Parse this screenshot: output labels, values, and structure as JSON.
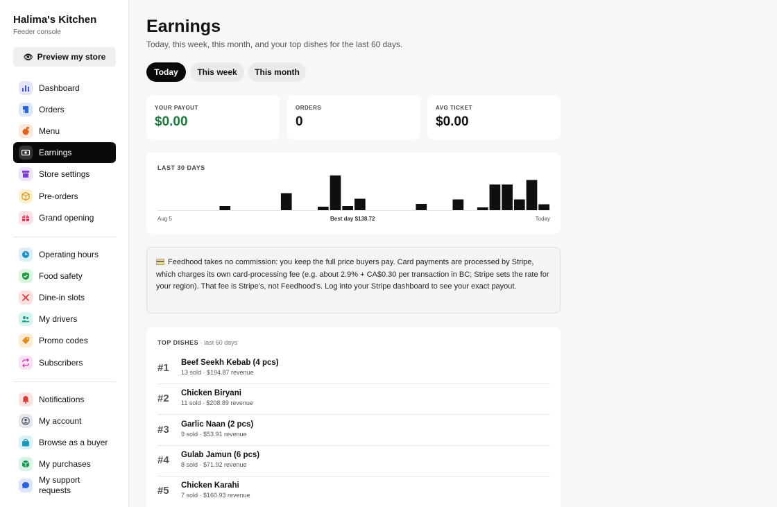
{
  "sidebar": {
    "brand": "Halima's Kitchen",
    "subtitle": "Feeder console",
    "preview_label": "Preview my store",
    "groups": [
      [
        {
          "label": "Dashboard",
          "icon": "bar-chart-icon",
          "color": "#e4e6fb",
          "fg": "#4a55d6"
        },
        {
          "label": "Orders",
          "icon": "receipt-icon",
          "color": "#dde7fb",
          "fg": "#2e62d9"
        },
        {
          "label": "Menu",
          "icon": "food-icon",
          "color": "#fde8d9",
          "fg": "#e2621b"
        },
        {
          "label": "Earnings",
          "icon": "money-icon",
          "color": "#333333",
          "fg": "#ffffff",
          "active": true
        },
        {
          "label": "Store settings",
          "icon": "store-icon",
          "color": "#ece3fb",
          "fg": "#7c3ad6"
        },
        {
          "label": "Pre-orders",
          "icon": "box-icon",
          "color": "#fdf0cf",
          "fg": "#d9941b"
        },
        {
          "label": "Grand opening",
          "icon": "gift-icon",
          "color": "#fde1e6",
          "fg": "#d93a57"
        }
      ],
      [
        {
          "label": "Operating hours",
          "icon": "clock-icon",
          "color": "#dbeff8",
          "fg": "#1f8fc6"
        },
        {
          "label": "Food safety",
          "icon": "shield-icon",
          "color": "#dcf4e2",
          "fg": "#1e9a48"
        },
        {
          "label": "Dine-in slots",
          "icon": "utensils-icon",
          "color": "#fde1e1",
          "fg": "#d93a3a"
        },
        {
          "label": "My drivers",
          "icon": "people-icon",
          "color": "#d8f3ee",
          "fg": "#16a08a"
        },
        {
          "label": "Promo codes",
          "icon": "tag-icon",
          "color": "#fdecd2",
          "fg": "#e28a1b"
        },
        {
          "label": "Subscribers",
          "icon": "repeat-icon",
          "color": "#f9e0f4",
          "fg": "#c93aa8"
        }
      ],
      [
        {
          "label": "Notifications",
          "icon": "bell-icon",
          "color": "#fde1e1",
          "fg": "#d93a3a"
        },
        {
          "label": "My account",
          "icon": "user-icon",
          "color": "#e6e8ee",
          "fg": "#555a6a"
        },
        {
          "label": "Browse as a buyer",
          "icon": "bag-icon",
          "color": "#d8f1f8",
          "fg": "#1c95b8"
        },
        {
          "label": "My purchases",
          "icon": "cube-icon",
          "color": "#d9f3e4",
          "fg": "#1a9a58"
        },
        {
          "label": "My support requests",
          "icon": "chat-icon",
          "color": "#dde5fb",
          "fg": "#2e62d9"
        }
      ]
    ]
  },
  "header": {
    "title": "Earnings",
    "subtitle": "Today, this week, this month, and your top dishes for the last 60 days."
  },
  "tabs": [
    {
      "label": "Today",
      "active": true
    },
    {
      "label": "This week",
      "active": false
    },
    {
      "label": "This month",
      "active": false
    }
  ],
  "stats": [
    {
      "label": "YOUR PAYOUT",
      "value": "$0.00",
      "accent": true
    },
    {
      "label": "ORDERS",
      "value": "0",
      "accent": false
    },
    {
      "label": "AVG TICKET",
      "value": "$0.00",
      "accent": false
    }
  ],
  "chart_data": {
    "type": "bar",
    "title": "LAST 30 DAYS",
    "values": [
      0,
      0,
      0,
      0,
      0,
      12,
      0,
      0,
      0,
      0,
      49,
      0,
      0,
      10,
      100,
      12,
      33,
      0,
      0,
      0,
      0,
      18,
      0,
      0,
      31,
      0,
      8,
      74,
      74,
      31,
      87,
      17
    ],
    "start_label": "Aug 5",
    "mid_label": "Best day $138.72",
    "end_label": "Today"
  },
  "note": {
    "text": "Feedhood takes no commission: you keep the full price buyers pay. Card payments are processed by Stripe, which charges its own card-processing fee (e.g. about 2.9% + CA$0.30 per transaction in BC; Stripe sets the rate for your region). That fee is Stripe's, not Feedhood's. Log into your Stripe dashboard to see your exact payout."
  },
  "top_dishes": {
    "title": "TOP DISHES",
    "suffix": "· last 60 days",
    "items": [
      {
        "rank": "#1",
        "name": "Beef Seekh Kebab (4 pcs)",
        "meta": "13 sold · $194.87 revenue"
      },
      {
        "rank": "#2",
        "name": "Chicken Biryani",
        "meta": "11 sold · $208.89 revenue"
      },
      {
        "rank": "#3",
        "name": "Garlic Naan (2 pcs)",
        "meta": "9 sold · $53.91 revenue"
      },
      {
        "rank": "#4",
        "name": "Gulab Jamun (6 pcs)",
        "meta": "8 sold · $71.92 revenue"
      },
      {
        "rank": "#5",
        "name": "Chicken Karahi",
        "meta": "7 sold · $160.93 revenue"
      }
    ]
  }
}
